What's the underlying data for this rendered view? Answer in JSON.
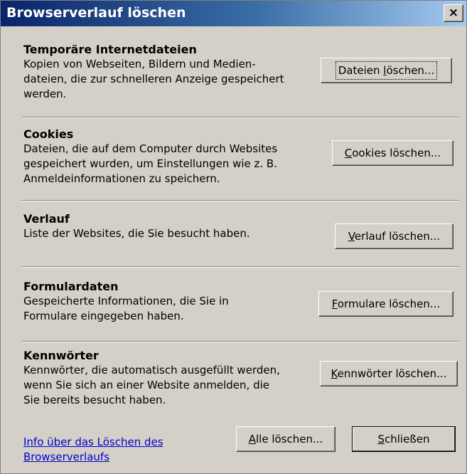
{
  "window": {
    "title": "Browserverlauf löschen",
    "close_glyph": "×"
  },
  "sections": [
    {
      "title": "Temporäre Internetdateien",
      "desc": [
        "Kopien von Webseiten, Bildern und Medien-",
        "dateien, die zur schnelleren Anzeige gespeichert",
        "werden."
      ],
      "button": {
        "pre": "Dateien ",
        "key": "l",
        "post": "öschen..."
      }
    },
    {
      "title": "Cookies",
      "desc": [
        "Dateien, die auf dem Computer durch Websites",
        "gespeichert wurden, um Einstellungen wie z. B.",
        "Anmeldeinformationen zu speichern."
      ],
      "button": {
        "pre": "",
        "key": "C",
        "post": "ookies löschen..."
      }
    },
    {
      "title": "Verlauf",
      "desc": [
        "Liste der Websites, die Sie besucht haben."
      ],
      "button": {
        "pre": "",
        "key": "V",
        "post": "erlauf löschen..."
      }
    },
    {
      "title": "Formulardaten",
      "desc": [
        "Gespeicherte Informationen, die Sie in",
        "Formulare eingegeben haben."
      ],
      "button": {
        "pre": "",
        "key": "F",
        "post": "ormulare löschen..."
      }
    },
    {
      "title": "Kennwörter",
      "desc": [
        "Kennwörter, die automatisch ausgefüllt werden,",
        "wenn Sie sich an einer Website anmelden, die",
        "Sie bereits besucht haben."
      ],
      "button": {
        "pre": "",
        "key": "K",
        "post": "ennwörter löschen..."
      }
    }
  ],
  "footer": {
    "info_link": [
      "Info über das Löschen des ",
      "Browserverlaufs"
    ],
    "delete_all": {
      "pre": "",
      "key": "A",
      "post": "lle löschen..."
    },
    "close": {
      "pre": "",
      "key": "S",
      "post": "chließen"
    }
  }
}
